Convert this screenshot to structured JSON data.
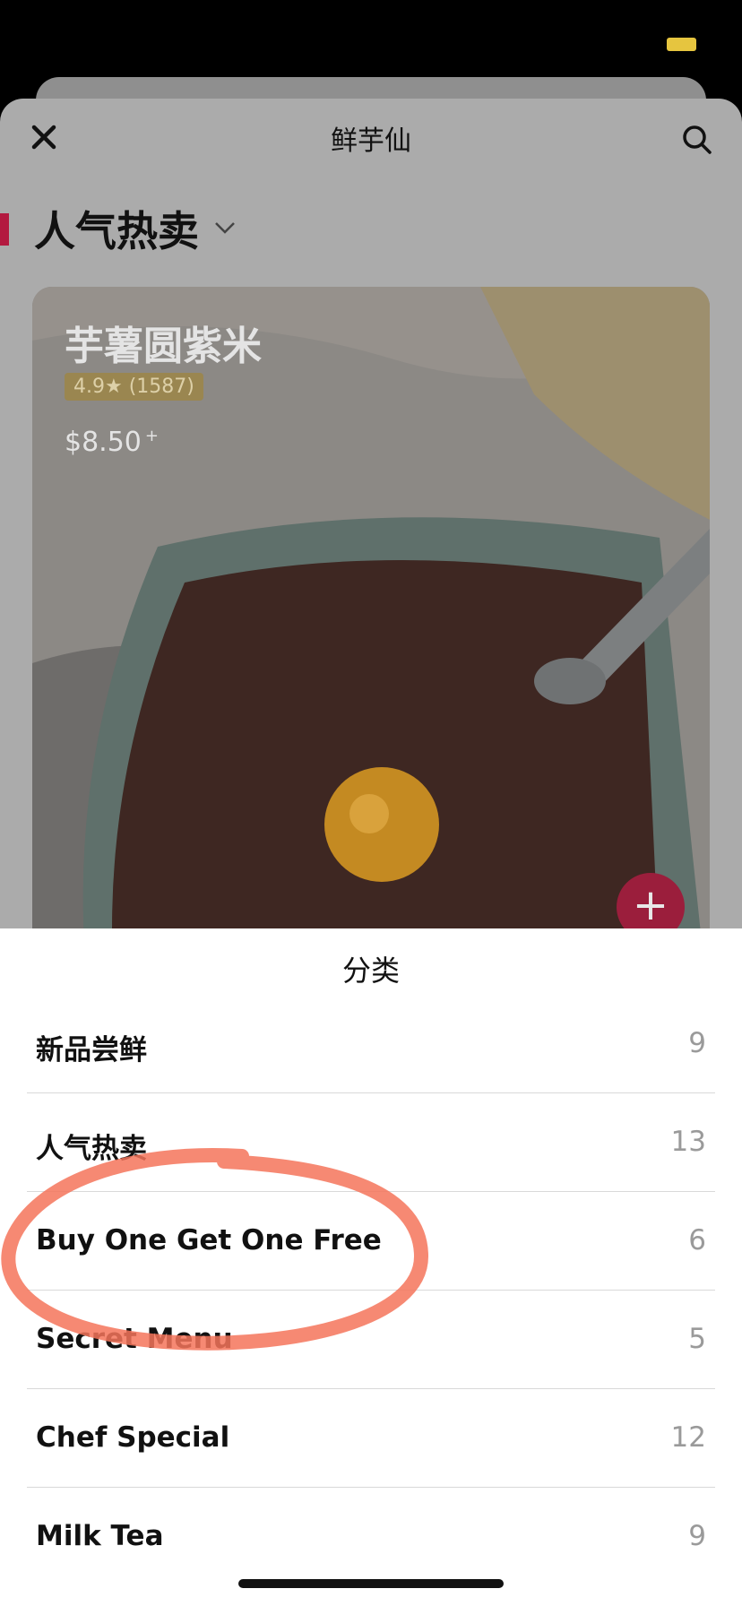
{
  "status_bar": {
    "battery_color": "#e6c53f"
  },
  "nav": {
    "title": "鲜芋仙",
    "close_icon": "close-icon",
    "search_icon": "search-icon"
  },
  "section": {
    "title": "人气热卖",
    "accent": "#b3193f"
  },
  "featured_item": {
    "name": "芋薯圆紫米",
    "rating": "4.9★ (1587)",
    "price": "$8.50",
    "price_suffix": "+",
    "add_label": "+"
  },
  "category_sheet": {
    "title": "分类",
    "categories": [
      {
        "name": "新品尝鲜",
        "count": "9"
      },
      {
        "name": "人气热卖",
        "count": "13"
      },
      {
        "name": "Buy One Get One Free",
        "count": "6"
      },
      {
        "name": "Secret Menu",
        "count": "5"
      },
      {
        "name": "Chef Special",
        "count": "12"
      },
      {
        "name": "Milk Tea",
        "count": "9"
      }
    ],
    "highlight_color": "#f4745a"
  }
}
